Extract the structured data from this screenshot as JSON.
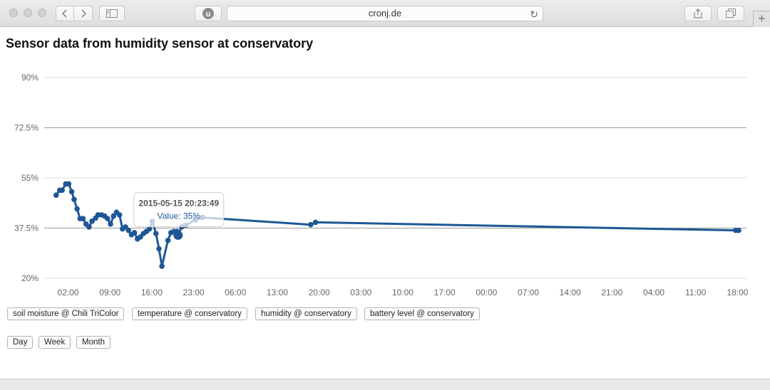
{
  "browser": {
    "url": "cronj.de"
  },
  "page": {
    "title": "Sensor data from humidity sensor at conservatory"
  },
  "chart_data": {
    "type": "line",
    "title": "",
    "xlabel": "",
    "ylabel": "",
    "ylim": [
      20,
      90
    ],
    "y_ticks": [
      "90%",
      "72.5%",
      "55%",
      "37.5%",
      "20%"
    ],
    "y_tick_values": [
      90,
      72.5,
      55,
      37.5,
      20
    ],
    "x_ticks": [
      "02:00",
      "09:00",
      "16:00",
      "23:00",
      "06:00",
      "13:00",
      "20:00",
      "03:00",
      "10:00",
      "17:00",
      "00:00",
      "07:00",
      "14:00",
      "21:00",
      "04:00",
      "11:00",
      "18:00"
    ],
    "x_tick_hours": [
      2,
      9,
      16,
      23,
      30,
      37,
      44,
      51,
      58,
      65,
      72,
      79,
      86,
      93,
      100,
      107,
      114
    ],
    "grid": true,
    "series_color": "#1f5796",
    "points": [
      {
        "h": 0.0,
        "v": 49.0
      },
      {
        "h": 0.6,
        "v": 50.7
      },
      {
        "h": 1.0,
        "v": 50.7
      },
      {
        "h": 1.6,
        "v": 52.9
      },
      {
        "h": 2.1,
        "v": 52.9
      },
      {
        "h": 2.6,
        "v": 50.2
      },
      {
        "h": 3.0,
        "v": 47.5
      },
      {
        "h": 3.5,
        "v": 44.2
      },
      {
        "h": 4.0,
        "v": 40.8
      },
      {
        "h": 4.5,
        "v": 40.8
      },
      {
        "h": 5.0,
        "v": 38.9
      },
      {
        "h": 5.5,
        "v": 37.9
      },
      {
        "h": 6.0,
        "v": 39.9
      },
      {
        "h": 6.6,
        "v": 41.0
      },
      {
        "h": 7.0,
        "v": 42.1
      },
      {
        "h": 7.6,
        "v": 42.1
      },
      {
        "h": 8.1,
        "v": 41.7
      },
      {
        "h": 8.6,
        "v": 40.8
      },
      {
        "h": 9.1,
        "v": 38.9
      },
      {
        "h": 9.6,
        "v": 41.7
      },
      {
        "h": 10.1,
        "v": 43.0
      },
      {
        "h": 10.6,
        "v": 42.1
      },
      {
        "h": 11.1,
        "v": 37.2
      },
      {
        "h": 11.6,
        "v": 37.9
      },
      {
        "h": 12.1,
        "v": 36.7
      },
      {
        "h": 12.6,
        "v": 35.2
      },
      {
        "h": 13.1,
        "v": 35.9
      },
      {
        "h": 13.6,
        "v": 33.7
      },
      {
        "h": 14.1,
        "v": 34.4
      },
      {
        "h": 14.6,
        "v": 35.6
      },
      {
        "h": 15.1,
        "v": 36.3
      },
      {
        "h": 15.6,
        "v": 37.2
      },
      {
        "h": 16.1,
        "v": 39.9
      },
      {
        "h": 16.7,
        "v": 35.6
      },
      {
        "h": 17.2,
        "v": 30.3
      },
      {
        "h": 17.7,
        "v": 24.2
      },
      {
        "h": 18.7,
        "v": 33.2
      },
      {
        "h": 19.2,
        "v": 35.9
      },
      {
        "h": 19.7,
        "v": 36.3
      },
      {
        "h": 20.2,
        "v": 36.3
      },
      {
        "h": 20.4,
        "v": 35.0
      },
      {
        "h": 21.0,
        "v": 37.9
      },
      {
        "h": 21.7,
        "v": 38.5
      },
      {
        "h": 23.3,
        "v": 40.4
      },
      {
        "h": 24.5,
        "v": 41.2
      },
      {
        "h": 42.6,
        "v": 38.7
      },
      {
        "h": 43.4,
        "v": 39.5
      },
      {
        "h": 113.7,
        "v": 36.7
      },
      {
        "h": 114.2,
        "v": 36.7
      }
    ],
    "highlight_index": 40,
    "tooltip": {
      "timestamp": "2015-05-15 20:23:49",
      "value": "Value: 35%"
    }
  },
  "sensor_buttons": [
    {
      "label": "soil moisture @ Chili TriColor"
    },
    {
      "label": "temperature @ conservatory"
    },
    {
      "label": "humidity @ conservatory"
    },
    {
      "label": "battery level @ conservatory"
    }
  ],
  "range_buttons": [
    {
      "label": "Day"
    },
    {
      "label": "Week"
    },
    {
      "label": "Month"
    }
  ]
}
